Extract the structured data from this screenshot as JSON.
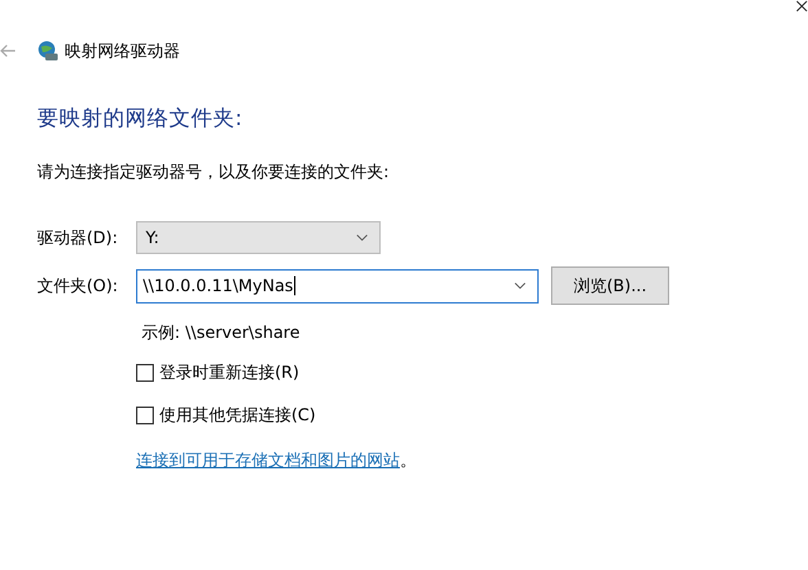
{
  "window": {
    "title": "映射网络驱动器"
  },
  "heading": "要映射的网络文件夹:",
  "instruction": "请为连接指定驱动器号，以及你要连接的文件夹:",
  "drive": {
    "label": "驱动器(D):",
    "value": "Y:"
  },
  "folder": {
    "label": "文件夹(O):",
    "value": "\\\\10.0.0.11\\MyNas"
  },
  "browse_button": "浏览(B)...",
  "example": "示例: \\\\server\\share",
  "checkboxes": [
    {
      "label": "登录时重新连接(R)",
      "checked": false
    },
    {
      "label": "使用其他凭据连接(C)",
      "checked": false
    }
  ],
  "link": {
    "text": "连接到可用于存储文档和图片的网站",
    "suffix": "。"
  }
}
